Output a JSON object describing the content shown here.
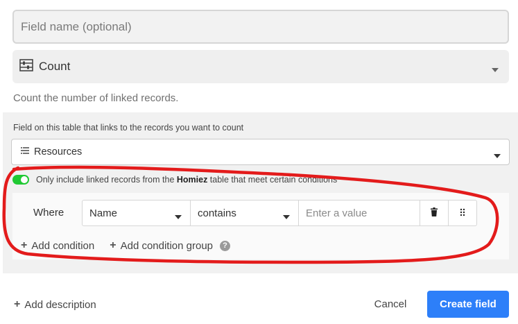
{
  "field_name": {
    "placeholder": "Field name (optional)",
    "value": ""
  },
  "field_type": {
    "label": "Count",
    "icon": "abacus-icon"
  },
  "type_description": "Count the number of linked records.",
  "link_panel": {
    "label": "Field on this table that links to the records you want to count",
    "selected": "Resources",
    "icon": "linked-records-icon"
  },
  "filter": {
    "enabled": true,
    "text_before": "Only include linked records from the ",
    "table_name": "Homiez",
    "text_after": " table that meet certain conditions",
    "toggle_color": "#20c933"
  },
  "condition": {
    "where_label": "Where",
    "field": "Name",
    "operator": "contains",
    "value_placeholder": "Enter a value"
  },
  "actions": {
    "add_condition": "Add condition",
    "add_condition_group": "Add condition group",
    "add_description": "Add description",
    "cancel": "Cancel",
    "create_field": "Create field"
  },
  "colors": {
    "primary": "#2d7ff9",
    "annotation": "#e31b1b"
  }
}
